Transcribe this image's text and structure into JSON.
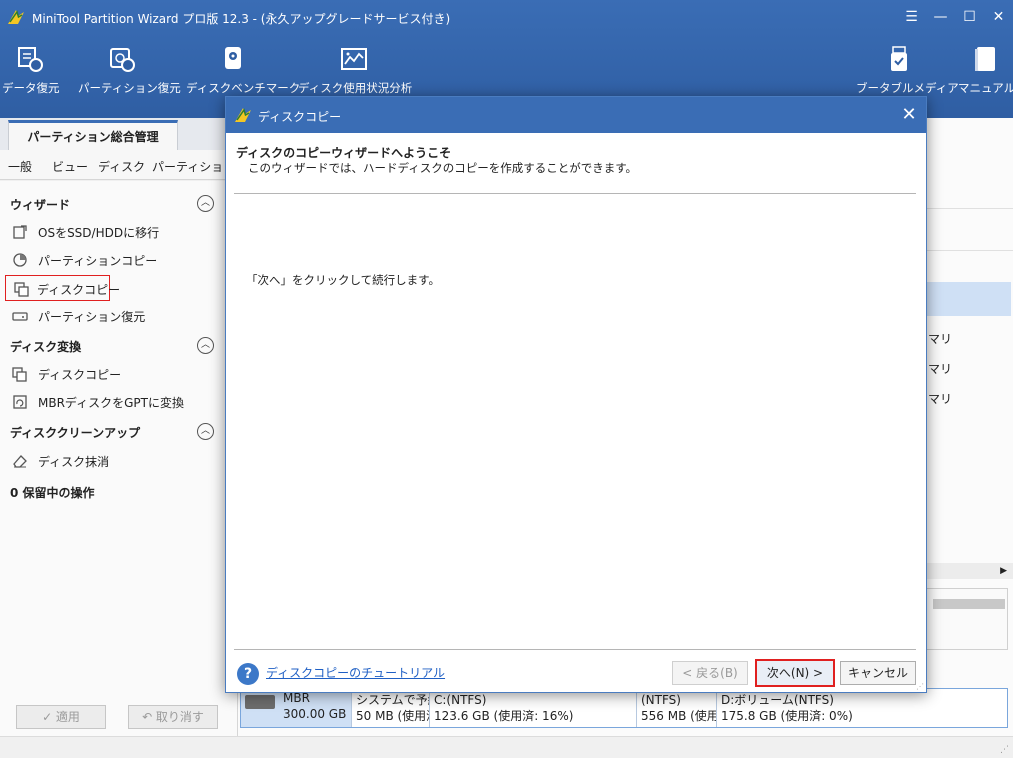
{
  "app": {
    "title": "MiniTool Partition Wizard プロ版 12.3 - (永久アップグレードサービス付き)",
    "window_controls": [
      "☰",
      "—",
      "☐",
      "✕"
    ]
  },
  "toolbar": [
    {
      "label": "データ復元",
      "icon": "data-recovery-icon"
    },
    {
      "label": "パーティション復元",
      "icon": "partition-recovery-icon"
    },
    {
      "label": "ディスクベンチマーク",
      "icon": "disk-benchmark-icon"
    },
    {
      "label": "ディスク使用状況分析",
      "icon": "space-analyzer-icon"
    },
    {
      "label": "ブータブルメディア",
      "icon": "bootable-media-icon"
    },
    {
      "label": "マニュアル",
      "icon": "manual-icon"
    }
  ],
  "main_tab": "パーティション総合管理",
  "menubar": [
    "一般",
    "ビュー",
    "ディスク",
    "パーティション"
  ],
  "sidebar": {
    "wizard": {
      "title": "ウィザード",
      "items": [
        "OSをSSD/HDDに移行",
        "パーティションコピー",
        "ディスクコピー",
        "パーティション復元"
      ]
    },
    "convert": {
      "title": "ディスク変換",
      "items": [
        "ディスクコピー",
        "MBRディスクをGPTに変換"
      ]
    },
    "cleanup": {
      "title": "ディスククリーンアップ",
      "items": [
        "ディスク抹消"
      ]
    },
    "pending": "0 保留中の操作"
  },
  "bottom_buttons": {
    "apply": "✓ 適用",
    "undo": "↶ 取り消す"
  },
  "right_fragments": [
    "マリ",
    "マリ",
    "マリ"
  ],
  "disk_map": {
    "disk": {
      "type": "MBR",
      "size": "300.00 GB"
    },
    "partitions": [
      {
        "label": "システムで予約",
        "detail": "50 MB (使用済"
      },
      {
        "label": "C:(NTFS)",
        "detail": "123.6 GB (使用済: 16%)"
      },
      {
        "label": "(NTFS)",
        "detail": "556 MB (使用"
      },
      {
        "label": "D:ボリューム(NTFS)",
        "detail": "175.8 GB (使用済: 0%)"
      }
    ]
  },
  "dialog": {
    "title": "ディスクコピー",
    "heading": "ディスクのコピーウィザードへようこそ",
    "subtitle": "このウィザードでは、ハードディスクのコピーを作成することができます。",
    "body": "「次へ」をクリックして続行します。",
    "help_link": "ディスクコピーのチュートリアル",
    "buttons": {
      "back": "< 戻る(B)",
      "next": "次へ(N) >",
      "cancel": "キャンセル"
    }
  },
  "colors": {
    "accent": "#3a6db5",
    "highlight_border": "#e02020",
    "link": "#1f5fc4"
  }
}
